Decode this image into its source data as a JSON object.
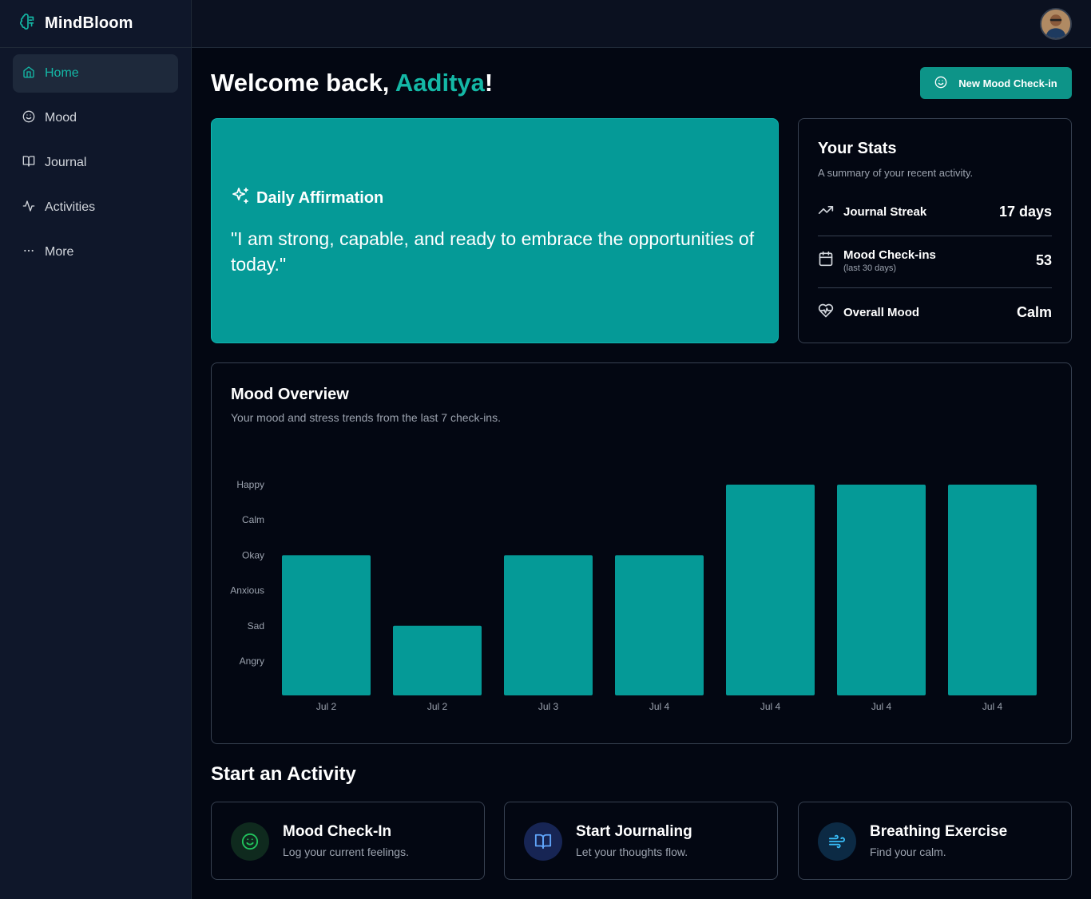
{
  "app": {
    "name": "MindBloom",
    "logo_icon": "brain-icon"
  },
  "sidebar": {
    "items": [
      {
        "label": "Home",
        "icon": "home-icon",
        "active": true
      },
      {
        "label": "Mood",
        "icon": "smile-icon",
        "active": false
      },
      {
        "label": "Journal",
        "icon": "book-icon",
        "active": false
      },
      {
        "label": "Activities",
        "icon": "activity-icon",
        "active": false
      },
      {
        "label": "More",
        "icon": "more-icon",
        "active": false
      }
    ]
  },
  "topbar": {
    "avatar_icon": "user-avatar"
  },
  "header": {
    "welcome_prefix": "Welcome back, ",
    "user_name": "Aaditya",
    "welcome_suffix": "!",
    "new_checkin_label": "New Mood Check-in"
  },
  "affirmation": {
    "title": "Daily Affirmation",
    "quote": "\"I am strong, capable, and ready to embrace the opportunities of today.\""
  },
  "stats": {
    "title": "Your Stats",
    "subtitle": "A summary of your recent activity.",
    "rows": [
      {
        "label": "Journal Streak",
        "sublabel": "",
        "value": "17 days",
        "icon": "trending-up-icon"
      },
      {
        "label": "Mood Check-ins",
        "sublabel": "(last 30 days)",
        "value": "53",
        "icon": "calendar-icon"
      },
      {
        "label": "Overall Mood",
        "sublabel": "",
        "value": "Calm",
        "icon": "heart-pulse-icon"
      }
    ]
  },
  "mood_overview": {
    "title": "Mood Overview",
    "subtitle": "Your mood and stress trends from the last 7 check-ins."
  },
  "chart_data": {
    "type": "bar",
    "categories": [
      "Jul 2",
      "Jul 2",
      "Jul 3",
      "Jul 4",
      "Jul 4",
      "Jul 4",
      "Jul 4"
    ],
    "values": [
      "Okay",
      "Sad",
      "Okay",
      "Okay",
      "Happy",
      "Happy",
      "Happy"
    ],
    "y_levels": [
      "Angry",
      "Sad",
      "Anxious",
      "Okay",
      "Calm",
      "Happy"
    ],
    "grid": false,
    "bar_color": "#059a97"
  },
  "activities": {
    "title": "Start an Activity",
    "items": [
      {
        "title": "Mood Check-In",
        "desc": "Log your current feelings.",
        "icon": "smile-icon",
        "color": "#22c55e",
        "bg": "#0f2a1e"
      },
      {
        "title": "Start Journaling",
        "desc": "Let your thoughts flow.",
        "icon": "book-icon",
        "color": "#60a5fa",
        "bg": "#172554"
      },
      {
        "title": "Breathing Exercise",
        "desc": "Find your calm.",
        "icon": "wind-icon",
        "color": "#38bdf8",
        "bg": "#0c2a44"
      }
    ]
  },
  "colors": {
    "accent": "#14b8a6",
    "brand_teal": "#0d9488",
    "bg": "#030712",
    "sidebar_bg": "#0f172a"
  }
}
